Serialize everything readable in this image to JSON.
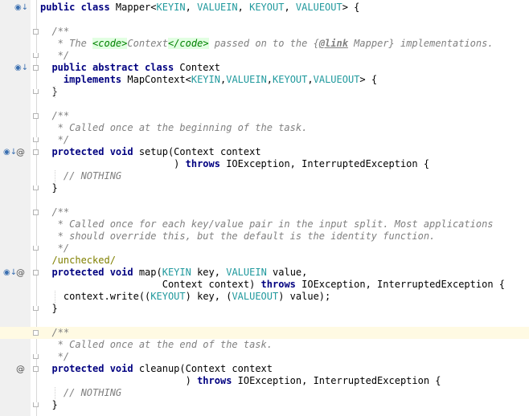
{
  "lines": [
    [
      {
        "c": "kw",
        "t": "public class "
      },
      {
        "c": "",
        "t": "Mapper<"
      },
      {
        "c": "tp",
        "t": "KEYIN"
      },
      {
        "c": "",
        "t": ", "
      },
      {
        "c": "tp",
        "t": "VALUEIN"
      },
      {
        "c": "",
        "t": ", "
      },
      {
        "c": "tp",
        "t": "KEYOUT"
      },
      {
        "c": "",
        "t": ", "
      },
      {
        "c": "tp",
        "t": "VALUEOUT"
      },
      {
        "c": "",
        "t": "> {"
      }
    ],
    [],
    [
      {
        "c": "cm",
        "t": "  /**"
      }
    ],
    [
      {
        "c": "cm",
        "t": "   * The "
      },
      {
        "c": "ct",
        "t": "<code>"
      },
      {
        "c": "cm",
        "t": "Context"
      },
      {
        "c": "ct",
        "t": "</code>"
      },
      {
        "c": "cm",
        "t": " passed on to the {"
      },
      {
        "c": "dl",
        "t": "@link"
      },
      {
        "c": "cm",
        "t": " Mapper} implementations."
      }
    ],
    [
      {
        "c": "cm",
        "t": "   */"
      }
    ],
    [
      {
        "c": "kw",
        "t": "  public abstract class "
      },
      {
        "c": "",
        "t": "Context"
      }
    ],
    [
      {
        "c": "kw",
        "t": "    implements "
      },
      {
        "c": "",
        "t": "MapContext<"
      },
      {
        "c": "tp",
        "t": "KEYIN"
      },
      {
        "c": "",
        "t": ","
      },
      {
        "c": "tp",
        "t": "VALUEIN"
      },
      {
        "c": "",
        "t": ","
      },
      {
        "c": "tp",
        "t": "KEYOUT"
      },
      {
        "c": "",
        "t": ","
      },
      {
        "c": "tp",
        "t": "VALUEOUT"
      },
      {
        "c": "",
        "t": "> {"
      }
    ],
    [
      {
        "c": "",
        "t": "  }"
      }
    ],
    [],
    [
      {
        "c": "cm",
        "t": "  /**"
      }
    ],
    [
      {
        "c": "cm",
        "t": "   * Called once at the beginning of the task."
      }
    ],
    [
      {
        "c": "cm",
        "t": "   */"
      }
    ],
    [
      {
        "c": "kw",
        "t": "  protected void "
      },
      {
        "c": "",
        "t": "setup(Context context"
      }
    ],
    [
      {
        "c": "",
        "t": "                       ) "
      },
      {
        "c": "kw",
        "t": "throws "
      },
      {
        "c": "",
        "t": "IOException, InterruptedException {"
      }
    ],
    [
      {
        "c": "cm",
        "t": "    // NOTHING"
      }
    ],
    [
      {
        "c": "",
        "t": "  }"
      }
    ],
    [],
    [
      {
        "c": "cm",
        "t": "  /**"
      }
    ],
    [
      {
        "c": "cm",
        "t": "   * Called once for each key/value pair in the input split. Most applications"
      }
    ],
    [
      {
        "c": "cm",
        "t": "   * should override this, but the default is the identity function."
      }
    ],
    [
      {
        "c": "cm",
        "t": "   */"
      }
    ],
    [
      {
        "c": "an",
        "t": "  /unchecked/"
      }
    ],
    [
      {
        "c": "kw",
        "t": "  protected void "
      },
      {
        "c": "",
        "t": "map("
      },
      {
        "c": "tp",
        "t": "KEYIN"
      },
      {
        "c": "",
        "t": " key, "
      },
      {
        "c": "tp",
        "t": "VALUEIN"
      },
      {
        "c": "",
        "t": " value,"
      }
    ],
    [
      {
        "c": "",
        "t": "                     Context context) "
      },
      {
        "c": "kw",
        "t": "throws "
      },
      {
        "c": "",
        "t": "IOException, InterruptedException {"
      }
    ],
    [
      {
        "c": "",
        "t": "    context.write(("
      },
      {
        "c": "tp",
        "t": "KEYOUT"
      },
      {
        "c": "",
        "t": ") key, ("
      },
      {
        "c": "tp",
        "t": "VALUEOUT"
      },
      {
        "c": "",
        "t": ") value);"
      }
    ],
    [
      {
        "c": "",
        "t": "  }"
      }
    ],
    [],
    [
      {
        "c": "cm",
        "t": "  /**"
      }
    ],
    [
      {
        "c": "cm",
        "t": "   * Called once at the end of the task."
      }
    ],
    [
      {
        "c": "cm",
        "t": "   */"
      }
    ],
    [
      {
        "c": "kw",
        "t": "  protected void "
      },
      {
        "c": "",
        "t": "cleanup(Context context"
      }
    ],
    [
      {
        "c": "",
        "t": "                         ) "
      },
      {
        "c": "kw",
        "t": "throws "
      },
      {
        "c": "",
        "t": "IOException, InterruptedException {"
      }
    ],
    [
      {
        "c": "cm",
        "t": "    // NOTHING"
      }
    ],
    [
      {
        "c": "",
        "t": "  }"
      }
    ]
  ],
  "current_line": 27,
  "gutter_icons": [
    {
      "line": 0,
      "icons": [
        "implemented-down-icon"
      ]
    },
    {
      "line": 5,
      "icons": [
        "implemented-down-icon"
      ]
    },
    {
      "line": 12,
      "icons": [
        "overridden-down-icon",
        "override-annotation-icon"
      ]
    },
    {
      "line": 22,
      "icons": [
        "overridden-down-icon",
        "override-annotation-icon"
      ]
    },
    {
      "line": 30,
      "icons": [
        "override-annotation-icon"
      ]
    }
  ]
}
